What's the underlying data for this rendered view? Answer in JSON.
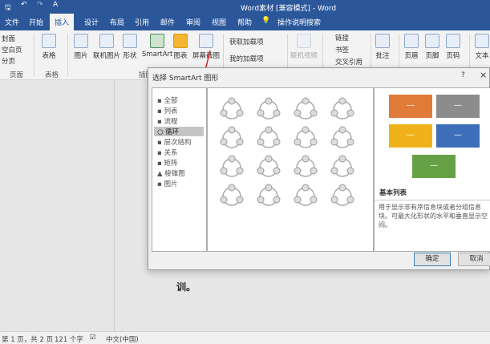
{
  "window": {
    "title": "Word素材 [兼容模式] - Word"
  },
  "qat": {
    "save": "save-icon",
    "undo": "undo-icon",
    "redo": "redo-icon",
    "format": "A"
  },
  "tabs": [
    "文件",
    "开始",
    "插入",
    "设计",
    "布局",
    "引用",
    "邮件",
    "审阅",
    "视图",
    "帮助",
    "操作说明搜索"
  ],
  "ribbon": {
    "pages": [
      "封面",
      "空白页",
      "分页"
    ],
    "pages_label": "页面",
    "table": "表格",
    "table_label": "表格",
    "illus": [
      "图片",
      "联机图片",
      "形状",
      "SmartArt",
      "图表",
      "屏幕截图"
    ],
    "illus_label": "插图",
    "addins": [
      "获取加载项",
      "我的加载项"
    ],
    "media": "联机视频",
    "links": [
      "链接",
      "书签",
      "交叉引用"
    ],
    "comment": "批注",
    "hf": [
      "页眉",
      "页脚",
      "页码"
    ],
    "text": "文本"
  },
  "dialog": {
    "title": "选择 SmartArt 图形",
    "help": "?",
    "close": "×",
    "categories": [
      "全部",
      "列表",
      "流程",
      "循环",
      "层次结构",
      "关系",
      "矩阵",
      "棱锥图",
      "图片"
    ],
    "selected_category": "循环",
    "preview_title": "基本列表",
    "preview_desc": "用于显示非有序信息块或者分组信息块。可最大化形状的水平和垂直显示空间。",
    "preview_colors": [
      "#e07b39",
      "#8c8c8c",
      "#f0b21a",
      "#3d6eb8",
      "#66a146"
    ],
    "ok": "确定",
    "cancel": "取消"
  },
  "document": {
    "text": "训。"
  },
  "status": {
    "page": "第 1 页，共 2 页",
    "words": "121 个字",
    "language": "中文(中国)"
  }
}
